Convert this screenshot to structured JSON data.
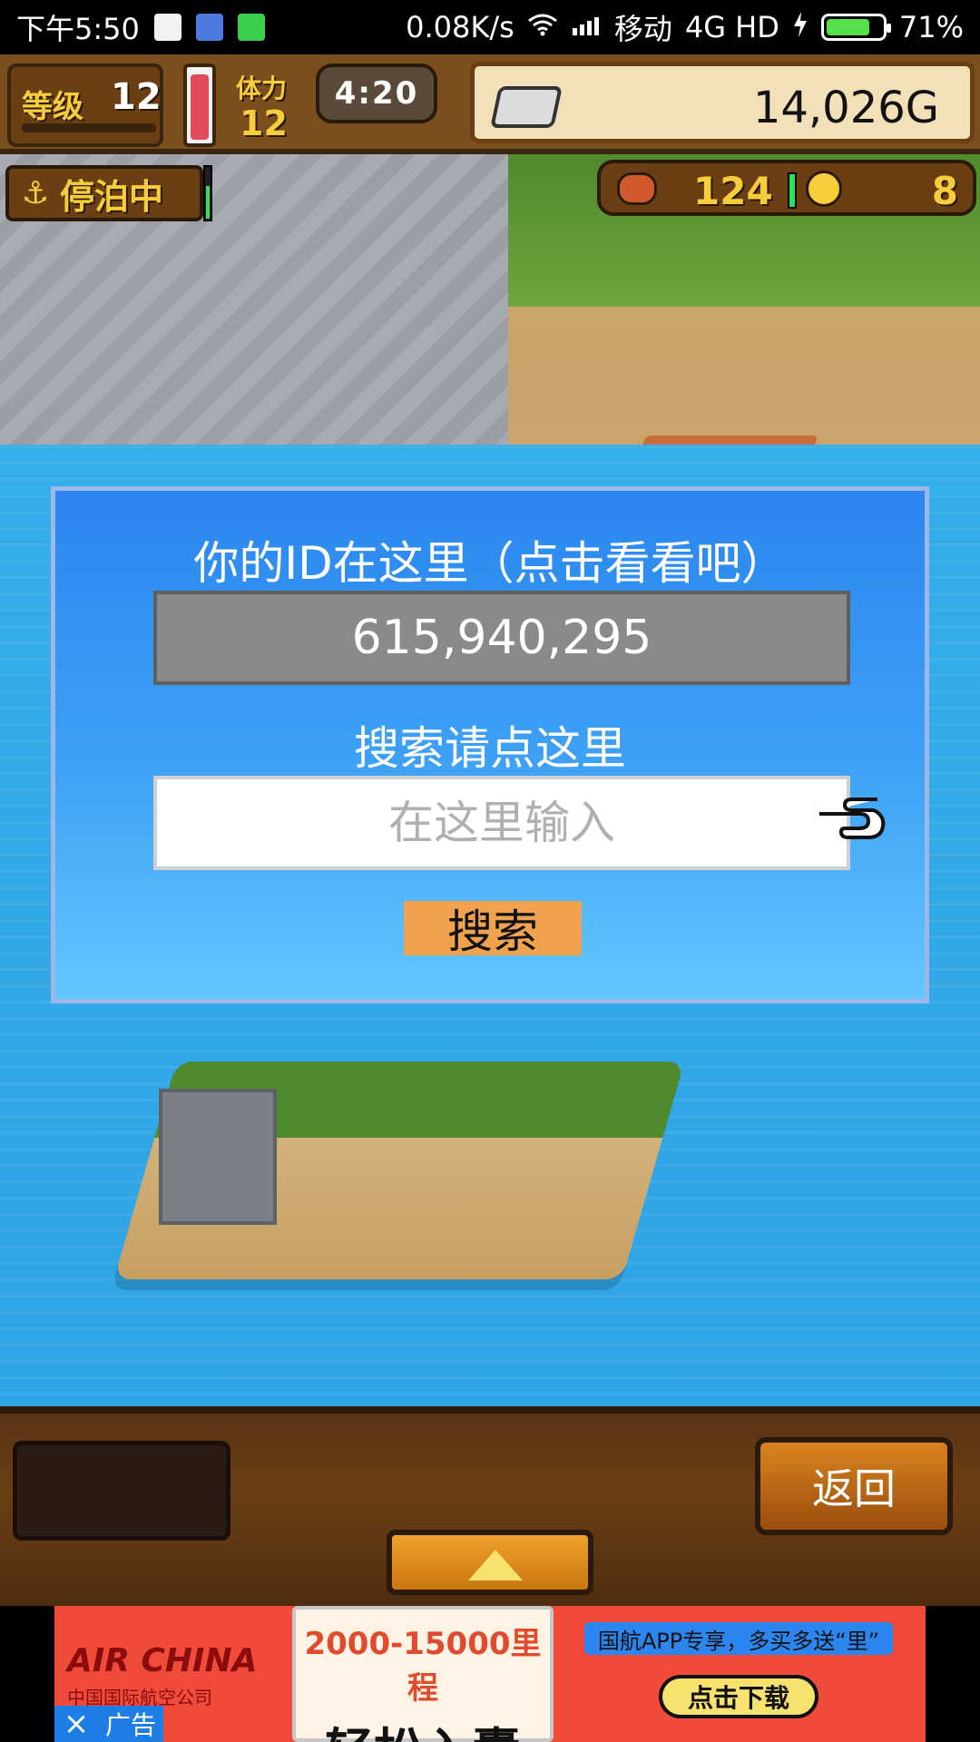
{
  "status_bar": {
    "time": "下午5:50",
    "net_speed": "0.08K/s",
    "carrier": "移动",
    "network": "4G HD",
    "battery_percent": "71%",
    "battery_level": 0.71
  },
  "hud": {
    "level_label": "等级",
    "level_value": "12",
    "stamina_label": "体力",
    "stamina_value": "12",
    "timer": "4:20",
    "gold": "14,026G",
    "status": "停泊中",
    "food": "124",
    "coins": "8"
  },
  "dialog": {
    "title": "你的ID在这里（点击看看吧）",
    "id_value": "615,940,295",
    "search_label": "搜索请点这里",
    "input_placeholder": "在这里输入",
    "search_button": "搜索"
  },
  "bottom": {
    "back_button": "返回"
  },
  "ad": {
    "brand_en": "AIR CHINA",
    "brand_cn": "中国国际航空公司",
    "headline_top": "2000-15000里程",
    "headline_main": "轻松入囊",
    "tag": "国航APP专享，多买多送“里”",
    "cta": "点击下载",
    "close": "×",
    "label": "广告"
  },
  "icons": {
    "wifi": "wifi-icon",
    "signal": "signal-icon",
    "charging": "charging-icon",
    "anchor": "anchor-icon",
    "food": "meat-icon",
    "coin": "coin-icon",
    "ingot": "silver-ingot-icon",
    "pointer": "hand-pointer-icon",
    "up": "up-arrow-icon"
  }
}
